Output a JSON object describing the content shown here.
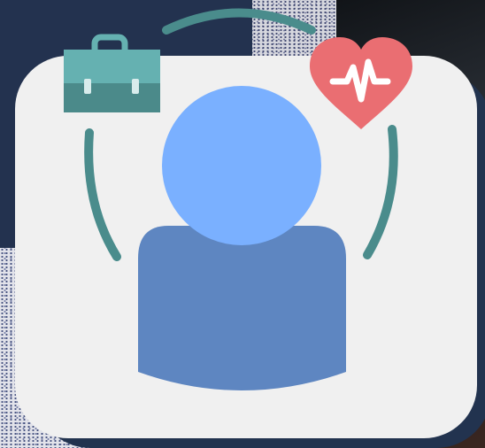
{
  "illustration": {
    "icons": [
      "briefcase-icon",
      "heart-pulse-icon",
      "person-icon"
    ],
    "colors": {
      "teal": "#4a8c8c",
      "briefcase_top": "#65b1b1",
      "briefcase_bottom": "#4b8a8a",
      "heart": "#ea6e72",
      "person_head": "#7ab0ff",
      "person_body": "#5e86c1",
      "card": "#f0f0f0",
      "navy": "#23324f"
    }
  }
}
